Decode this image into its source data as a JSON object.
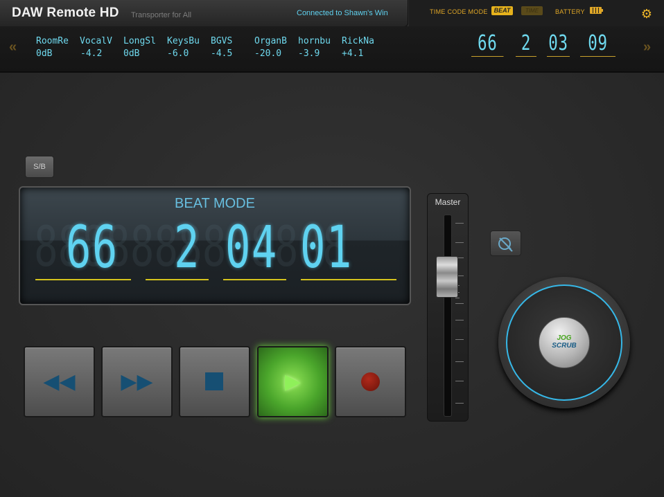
{
  "header": {
    "title": "DAW Remote HD",
    "subtitle": "Transporter for All",
    "connection": "Connected to Shawn's Win",
    "timecode_mode_label": "TIME CODE MODE",
    "beat_button": "BEAT",
    "time_button": "TIME",
    "battery_label": "BATTERY",
    "settings_icon": "gear-icon"
  },
  "tracks": [
    {
      "name": "RoomRe",
      "value": "0dB"
    },
    {
      "name": "VocalV",
      "value": "-4.2"
    },
    {
      "name": "LongSl",
      "value": "0dB"
    },
    {
      "name": "KeysBu",
      "value": "-6.0"
    },
    {
      "name": "BGVS",
      "value": "-4.5"
    },
    {
      "name": "OrganB",
      "value": "-20.0"
    },
    {
      "name": "hornbu",
      "value": "-3.9"
    },
    {
      "name": "RickNa",
      "value": "+4.1"
    }
  ],
  "mini_timecode": {
    "bar": "66",
    "beat": "2",
    "sixteenth": "03",
    "tick": "09"
  },
  "sb_button": "S/B",
  "display": {
    "mode": "BEAT MODE",
    "bar": "66",
    "beat": "2",
    "sixteenth": "04",
    "tick": "01"
  },
  "transport": {
    "rewind_icon": "rewind-icon",
    "fast_forward_icon": "fast-forward-icon",
    "stop_icon": "stop-icon",
    "play_icon": "play-icon",
    "record_icon": "record-icon",
    "play_active": true
  },
  "master": {
    "label": "Master"
  },
  "jog": {
    "line1": "JOG",
    "line2": "SCRUB"
  },
  "colors": {
    "accent": "#5fd2f0",
    "header_gold": "#e0a727",
    "play_green": "#6ad23c",
    "record_red": "#b02a1b"
  }
}
